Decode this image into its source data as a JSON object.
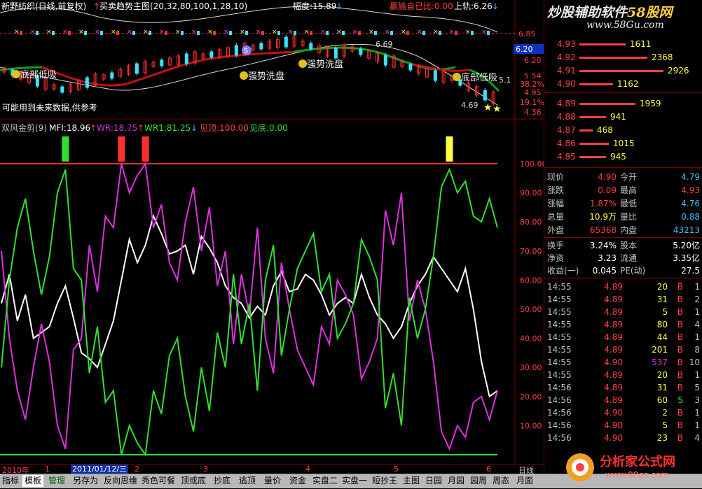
{
  "top_panel": {
    "stock_label": "新野纺织(日线,前复权)",
    "indicator_label": "买卖趋势主图(20,32,80,100,1,28,10)",
    "amplitude_label": "幅度:15.89",
    "win_loss_label": "赢输自已比:0.00",
    "upper_rail_label": "上轨:6.26",
    "note": "可能用到未来数据,供参考",
    "annotations": [
      "底部低吸",
      "强势洗盘",
      "强势洗盘",
      "底部低吸"
    ],
    "price_marks": [
      "6.69",
      "4.69",
      "5.1"
    ],
    "badge": "5"
  },
  "price_axis": [
    "6.85",
    "6.20",
    "5.54",
    "4.95",
    "4.36"
  ],
  "price_axis_extra": [
    "38.2%",
    "19.1%"
  ],
  "current_price_tag": "6.20",
  "lower_panel": {
    "name": "双风金剪(9)",
    "mfi_label": "MFI:18.96",
    "wr_label": "WR:18.75",
    "wr1_label": "WR1:81.25",
    "top_label": "见顶:100.00",
    "bottom_label": "见底:0.00"
  },
  "osc_axis": [
    "100.00",
    "90.00",
    "80.00",
    "70.00",
    "60.00",
    "50.00",
    "40.00",
    "30.00",
    "20.00",
    "10.00"
  ],
  "timebar": {
    "year": "2010年",
    "date_box": "2011/01/12/三",
    "months": [
      "1",
      "2",
      "3",
      "4",
      "5",
      "6"
    ],
    "period": "日线"
  },
  "watermark": {
    "line1": "炒股辅助软件",
    "brand": "58股网",
    "url": "www.58Gu.com"
  },
  "order_book": {
    "asks": [
      {
        "price": "4.93",
        "volume": "1611",
        "bar": 0.55
      },
      {
        "price": "4.92",
        "volume": "2368",
        "bar": 0.81
      },
      {
        "price": "4.91",
        "volume": "2926",
        "bar": 1.0
      },
      {
        "price": "4.90",
        "volume": "1162",
        "bar": 0.4
      }
    ],
    "bids": [
      {
        "price": "4.89",
        "volume": "1959",
        "bar": 0.67
      },
      {
        "price": "4.88",
        "volume": "941",
        "bar": 0.32
      },
      {
        "price": "4.87",
        "volume": "468",
        "bar": 0.16
      },
      {
        "price": "4.86",
        "volume": "1015",
        "bar": 0.35
      },
      {
        "price": "4.85",
        "volume": "945",
        "bar": 0.32
      }
    ]
  },
  "quote": [
    {
      "l1": "现价",
      "v1": "4.90",
      "c1": "#ff4040",
      "l2": "今开",
      "v2": "4.79",
      "c2": "#40c0ff"
    },
    {
      "l1": "涨跌",
      "v1": "0.09",
      "c1": "#ff4040",
      "l2": "最高",
      "v2": "4.93",
      "c2": "#ff4040"
    },
    {
      "l1": "涨幅",
      "v1": "1.87%",
      "c1": "#ff4040",
      "l2": "最低",
      "v2": "4.76",
      "c2": "#40c0ff"
    },
    {
      "l1": "总量",
      "v1": "10.9万",
      "c1": "#ffff40",
      "l2": "量比",
      "v2": "0.88",
      "c2": "#40c0ff"
    },
    {
      "l1": "外盘",
      "v1": "65368",
      "c1": "#ff4040",
      "l2": "内盘",
      "v2": "43213",
      "c2": "#40c0ff"
    }
  ],
  "finance": [
    {
      "l1": "换手",
      "v1": "3.24%",
      "l2": "股本",
      "v2": "5.20亿"
    },
    {
      "l1": "净资",
      "v1": "3.23",
      "l2": "流通",
      "v2": "3.35亿"
    },
    {
      "l1": "收益(一)",
      "v1": "0.045",
      "l2": "PE(动)",
      "v2": "27.5"
    }
  ],
  "ticks": [
    {
      "t": "14:55",
      "p": "4.89",
      "v": "20",
      "s": "B",
      "n": "1"
    },
    {
      "t": "14:55",
      "p": "4.89",
      "v": "31",
      "s": "B",
      "n": "2"
    },
    {
      "t": "14:55",
      "p": "4.89",
      "v": "5",
      "s": "B",
      "n": "1"
    },
    {
      "t": "14:55",
      "p": "4.89",
      "v": "80",
      "s": "B",
      "n": "4"
    },
    {
      "t": "14:55",
      "p": "4.89",
      "v": "44",
      "s": "B",
      "n": "1"
    },
    {
      "t": "14:55",
      "p": "4.89",
      "v": "201",
      "s": "B",
      "n": "8"
    },
    {
      "t": "14:55",
      "p": "4.90",
      "v": "537",
      "s": "B",
      "n": "10"
    },
    {
      "t": "14:55",
      "p": "4.89",
      "v": "20",
      "s": "B",
      "n": "1"
    },
    {
      "t": "14:56",
      "p": "4.89",
      "v": "31",
      "s": "B",
      "n": "5"
    },
    {
      "t": "14:56",
      "p": "4.89",
      "v": "60",
      "s": "S",
      "n": "3"
    },
    {
      "t": "14:56",
      "p": "4.90",
      "v": "2",
      "s": "B",
      "n": "1"
    },
    {
      "t": "14:56",
      "p": "4.90",
      "v": "5",
      "s": "B",
      "n": "1"
    },
    {
      "t": "14:56",
      "p": "4.90",
      "v": "23",
      "s": "B",
      "n": "4"
    }
  ],
  "tabs": [
    "指标",
    "模板",
    "管理",
    "另存为",
    "反向思维",
    "秀色可餐",
    "顶或底",
    "抄底",
    "逃顶",
    "量价",
    "资金",
    "实盘二",
    "实盘一",
    "短抄王",
    "主图",
    "日园",
    "月园",
    "园周",
    "周态",
    "月面"
  ],
  "active_tab": "模板",
  "bottom_logo": {
    "text": "分析家公式网",
    "url": "www.88gs.com"
  },
  "right_edge_label": "笔",
  "colors": {
    "red": "#ff3030",
    "green": "#30e030",
    "magenta": "#e030e0",
    "white": "#ffffff",
    "cyan": "#40c0ff",
    "yellow": "#ffff40",
    "grid": "#7a0000"
  },
  "chart_data": {
    "type": "line",
    "title": "双风金剪(9)",
    "ylim": [
      0,
      100
    ],
    "series": [
      {
        "name": "MFI",
        "values": [
          52,
          62,
          46,
          55,
          40,
          42,
          44,
          52,
          58,
          47,
          35,
          33,
          30,
          38,
          46,
          60,
          74,
          66,
          72,
          82,
          76,
          69,
          70,
          72,
          62,
          75,
          71,
          66,
          58,
          54,
          52,
          47,
          51,
          48,
          58,
          63,
          56,
          57,
          62,
          60,
          55,
          48,
          52,
          54,
          52,
          62,
          54,
          48,
          45,
          40,
          44,
          52,
          58,
          62,
          68,
          64,
          60,
          56,
          64,
          50,
          32,
          20,
          22
        ]
      },
      {
        "name": "WR",
        "values": [
          70,
          40,
          22,
          12,
          30,
          45,
          32,
          10,
          2,
          36,
          40,
          72,
          56,
          82,
          78,
          100,
          90,
          96,
          100,
          78,
          86,
          66,
          60,
          80,
          92,
          70,
          85,
          58,
          70,
          38,
          62,
          48,
          78,
          40,
          28,
          66,
          50,
          36,
          30,
          24,
          44,
          38,
          60,
          55,
          48,
          26,
          32,
          40,
          84,
          72,
          90,
          46,
          60,
          50,
          32,
          8,
          2,
          10,
          6,
          18,
          20,
          12,
          22
        ]
      },
      {
        "name": "WR1",
        "values": [
          30,
          60,
          78,
          88,
          70,
          55,
          68,
          90,
          98,
          64,
          60,
          28,
          44,
          18,
          22,
          0,
          10,
          4,
          0,
          22,
          14,
          34,
          40,
          20,
          8,
          30,
          15,
          42,
          30,
          62,
          38,
          52,
          22,
          60,
          72,
          34,
          50,
          64,
          70,
          76,
          56,
          62,
          40,
          45,
          52,
          74,
          68,
          60,
          16,
          28,
          10,
          54,
          40,
          50,
          68,
          92,
          98,
          90,
          94,
          82,
          80,
          88,
          78
        ]
      }
    ],
    "signals": [
      {
        "type": "bottom",
        "index": 8
      },
      {
        "type": "top",
        "index": 15
      },
      {
        "type": "top",
        "index": 18
      },
      {
        "type": "bottom",
        "index": 56
      }
    ]
  }
}
